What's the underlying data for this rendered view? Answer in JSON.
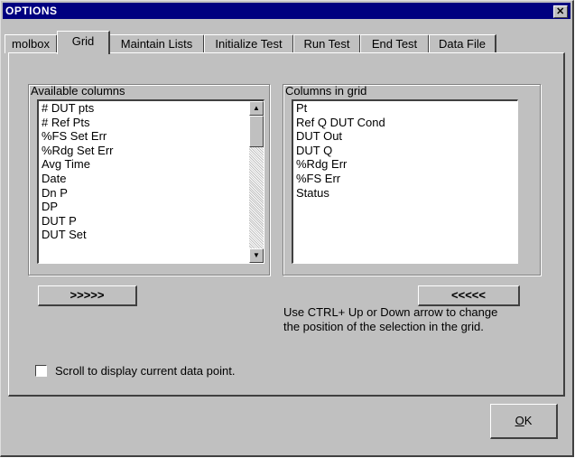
{
  "window": {
    "title": "OPTIONS",
    "close_glyph": "✕"
  },
  "tabs": [
    {
      "label": "molbox"
    },
    {
      "label": "Grid",
      "active": true
    },
    {
      "label": "Maintain Lists"
    },
    {
      "label": "Initialize Test"
    },
    {
      "label": "Run Test"
    },
    {
      "label": "End Test"
    },
    {
      "label": "Data File"
    }
  ],
  "available": {
    "label": "Available columns",
    "items": [
      "# DUT pts",
      "# Ref Pts",
      "%FS Set Err",
      "%Rdg Set Err",
      "Avg Time",
      "Date",
      "Dn P",
      "DP",
      "DUT P",
      "DUT Set"
    ]
  },
  "in_grid": {
    "label": "Columns in grid",
    "items": [
      "Pt",
      "Ref Q DUT Cond",
      "DUT Out",
      "DUT Q",
      "%Rdg Err",
      "%FS Err",
      "Status"
    ]
  },
  "buttons": {
    "add": ">>>>>",
    "remove": "<<<<<",
    "ok": "OK"
  },
  "hint": "Use CTRL+ Up or Down arrow to change the position of the selection in the grid.",
  "scroll_checkbox": {
    "label": "Scroll to display current data point.",
    "checked": false
  },
  "icons": {
    "scroll_up": "up-arrow-icon",
    "scroll_down": "down-arrow-icon",
    "close": "close-icon"
  }
}
